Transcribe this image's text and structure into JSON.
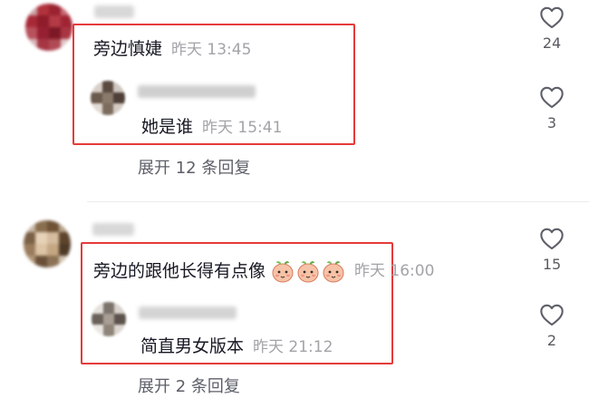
{
  "comments": [
    {
      "text": "旁边慎婕",
      "date": "昨天",
      "time": "13:45",
      "likes": "24",
      "reply": {
        "text": "她是谁",
        "date": "昨天",
        "time": "15:41",
        "likes": "3"
      },
      "expand": {
        "prefix": "展开",
        "count": "12",
        "suffix": "条回复"
      }
    },
    {
      "text": "旁边的跟他长得有点像",
      "emoji": "peach-face-emoji",
      "emoji_count": 3,
      "date": "昨天",
      "time": "16:00",
      "likes": "15",
      "reply": {
        "text": "简直男女版本",
        "date": "昨天",
        "time": "21:12",
        "likes": "2"
      },
      "expand": {
        "prefix": "展开",
        "count": "2",
        "suffix": "条回复"
      }
    }
  ],
  "icons": {
    "like": "heart-outline-icon"
  },
  "colors": {
    "highlight_box": "#e53a3a",
    "meta_text": "#a3a3a8",
    "primary_text": "#161823"
  }
}
